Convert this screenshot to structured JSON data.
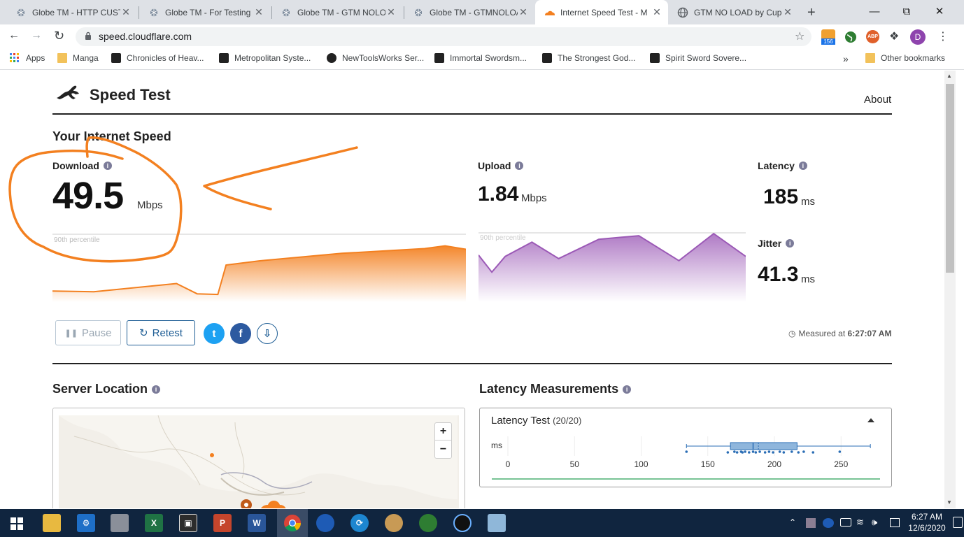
{
  "browser": {
    "tabs": [
      {
        "title": "Globe TM - HTTP CUSTO",
        "close": "✕"
      },
      {
        "title": "Globe TM - For Testing",
        "close": "✕"
      },
      {
        "title": "Globe TM - GTM NOLOA",
        "close": "✕"
      },
      {
        "title": "Globe TM - GTMNOLOA",
        "close": "✕"
      },
      {
        "title": "Internet Speed Test - M",
        "close": "✕"
      },
      {
        "title": "GTM NO LOAD by Cupc",
        "close": "✕"
      }
    ],
    "new_tab": "+",
    "url": "speed.cloudflare.com",
    "extensions": {
      "badge_count": "156",
      "abp": "ABP",
      "profile_initial": "D"
    },
    "bookmarks": [
      {
        "label": "Apps"
      },
      {
        "label": "Manga"
      },
      {
        "label": "Chronicles of Heav..."
      },
      {
        "label": "Metropolitan Syste..."
      },
      {
        "label": "NewToolsWorks Ser..."
      },
      {
        "label": "Immortal Swordsm..."
      },
      {
        "label": "The Strongest God..."
      },
      {
        "label": "Spirit Sword Sovere..."
      }
    ],
    "more_bookmarks": "»",
    "other_bookmarks": "Other bookmarks"
  },
  "header": {
    "title": "Speed Test",
    "about": "About"
  },
  "speed": {
    "heading": "Your Internet Speed",
    "download": {
      "label": "Download",
      "value": "49.5",
      "unit": "Mbps"
    },
    "upload": {
      "label": "Upload",
      "value": "1.84",
      "unit": "Mbps"
    },
    "latency": {
      "label": "Latency",
      "value": "185",
      "unit": "ms"
    },
    "jitter": {
      "label": "Jitter",
      "value": "41.3",
      "unit": "ms"
    },
    "percentile_label": "90th percentile",
    "download_trace": [
      [
        0,
        0.12
      ],
      [
        10,
        0.11
      ],
      [
        30,
        0.23
      ],
      [
        35,
        0.08
      ],
      [
        40,
        0.07
      ],
      [
        42,
        0.5
      ],
      [
        50,
        0.56
      ],
      [
        70,
        0.67
      ],
      [
        90,
        0.74
      ],
      [
        95,
        0.78
      ],
      [
        100,
        0.73
      ]
    ],
    "upload_trace": [
      [
        0,
        0.66
      ],
      [
        5,
        0.42
      ],
      [
        10,
        0.64
      ],
      [
        20,
        0.84
      ],
      [
        30,
        0.61
      ],
      [
        45,
        0.88
      ],
      [
        60,
        0.93
      ],
      [
        75,
        0.58
      ],
      [
        88,
        0.96
      ],
      [
        100,
        0.64
      ]
    ]
  },
  "controls": {
    "pause": "Pause",
    "retest": "Retest",
    "twitter": "t",
    "facebook": "f",
    "download_results": "⇩"
  },
  "measured": {
    "prefix": "Measured at",
    "time": "6:27:07 AM"
  },
  "server_location": {
    "heading": "Server Location",
    "zoom_in": "+",
    "zoom_out": "−"
  },
  "latency_measurements": {
    "heading": "Latency Measurements",
    "card_title": "Latency Test",
    "card_count": "(20/20)",
    "axis_unit": "ms",
    "ticks": [
      "0",
      "50",
      "100",
      "150",
      "200",
      "250"
    ],
    "box": {
      "min": 134,
      "q1": 167,
      "median": 184,
      "mean": 188,
      "q3": 217,
      "max": 272
    },
    "points": [
      134,
      165,
      170,
      172,
      175,
      176,
      178,
      181,
      184,
      186,
      189,
      193,
      196,
      199,
      204,
      207,
      213,
      218,
      222,
      229,
      249
    ]
  },
  "taskbar": {
    "clock_time": "6:27 AM",
    "clock_date": "12/6/2020",
    "apps": [
      "X",
      "P",
      "W"
    ]
  },
  "colors": {
    "download": "#f38020",
    "upload": "#9b59b6",
    "accent": "#1f5e95",
    "annotation": "#f38020"
  }
}
